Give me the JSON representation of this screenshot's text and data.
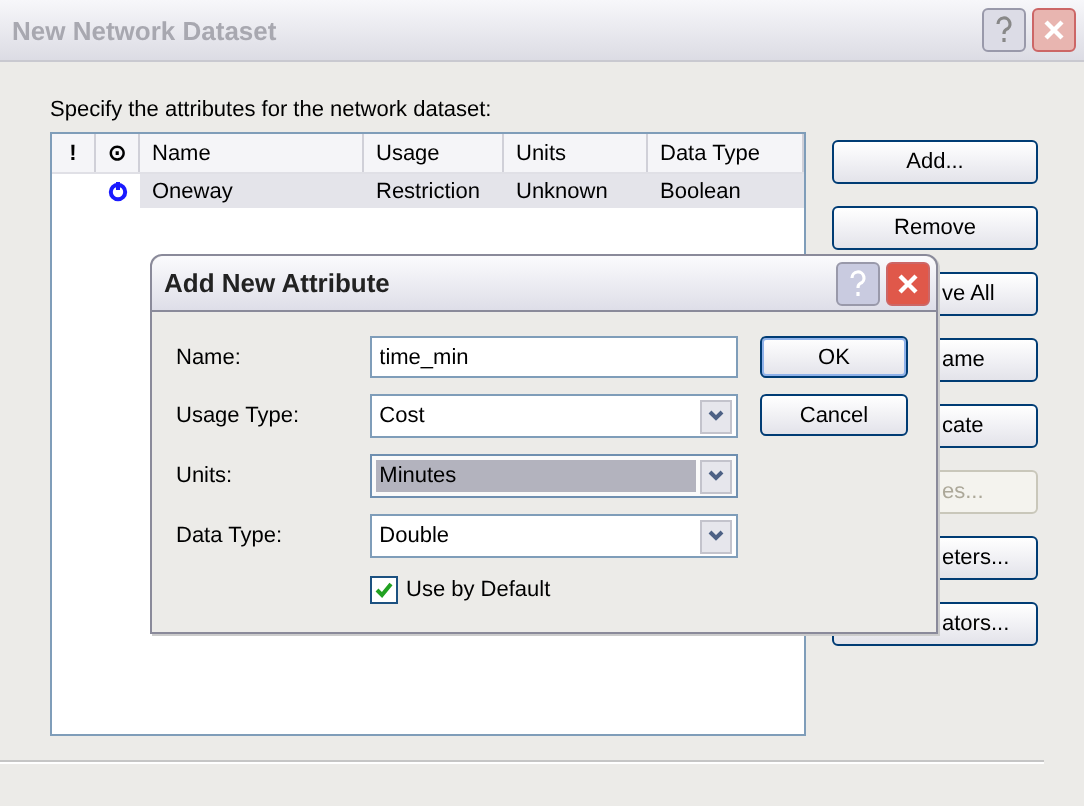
{
  "window": {
    "title": "New Network Dataset",
    "active": false
  },
  "instruction": "Specify the attributes for the network dataset:",
  "table": {
    "columns": [
      "!",
      "⊙",
      "Name",
      "Usage",
      "Units",
      "Data Type"
    ],
    "rows": [
      {
        "default_icon": true,
        "name": "Oneway",
        "usage": "Restriction",
        "units": "Unknown",
        "data_type": "Boolean",
        "selected": true
      }
    ]
  },
  "buttons": [
    {
      "label": "Add...",
      "disabled": false
    },
    {
      "label": "Remove",
      "disabled": false
    },
    {
      "label": "ve All",
      "disabled": false
    },
    {
      "label": "ame",
      "disabled": false
    },
    {
      "label": "cate",
      "disabled": false
    },
    {
      "label": "es...",
      "disabled": true
    },
    {
      "label": "eters...",
      "disabled": false
    },
    {
      "label": "ators...",
      "disabled": false
    }
  ],
  "dialog": {
    "title": "Add New Attribute",
    "fields": [
      {
        "kind": "text",
        "label": "Name:",
        "value": "time_min"
      },
      {
        "kind": "combo",
        "label": "Usage Type:",
        "value": "Cost",
        "focused": false
      },
      {
        "kind": "combo",
        "label": "Units:",
        "value": "Minutes",
        "focused": true
      },
      {
        "kind": "combo",
        "label": "Data Type:",
        "value": "Double",
        "focused": false
      }
    ],
    "checkbox": {
      "label": "Use by Default",
      "checked": true
    },
    "buttons": [
      {
        "label": "OK",
        "default": true
      },
      {
        "label": "Cancel",
        "default": false
      }
    ]
  }
}
